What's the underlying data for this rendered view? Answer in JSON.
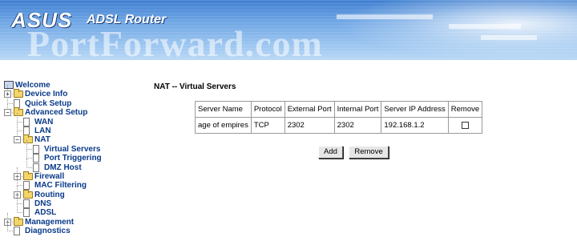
{
  "header": {
    "brand": "ASUS",
    "product": "ADSL Router",
    "watermark": "PortForward.com"
  },
  "nav": {
    "items": [
      {
        "label": "Welcome",
        "level": 0,
        "icon": "computer-icon"
      },
      {
        "label": "Device Info",
        "level": 1,
        "icon": "folder-icon",
        "toggle": "+"
      },
      {
        "label": "Quick Setup",
        "level": 1,
        "icon": "document-icon"
      },
      {
        "label": "Advanced Setup",
        "level": 1,
        "icon": "folder-icon",
        "toggle": "−"
      },
      {
        "label": "WAN",
        "level": 2,
        "icon": "document-icon"
      },
      {
        "label": "LAN",
        "level": 2,
        "icon": "document-icon"
      },
      {
        "label": "NAT",
        "level": 2,
        "icon": "folder-icon",
        "toggle": "−"
      },
      {
        "label": "Virtual Servers",
        "level": 3,
        "icon": "document-icon"
      },
      {
        "label": "Port Triggering",
        "level": 3,
        "icon": "document-icon"
      },
      {
        "label": "DMZ Host",
        "level": 3,
        "icon": "document-icon"
      },
      {
        "label": "Firewall",
        "level": 2,
        "icon": "folder-icon",
        "toggle": "+"
      },
      {
        "label": "MAC Filtering",
        "level": 2,
        "icon": "document-icon"
      },
      {
        "label": "Routing",
        "level": 2,
        "icon": "folder-icon",
        "toggle": "+"
      },
      {
        "label": "DNS",
        "level": 2,
        "icon": "document-icon"
      },
      {
        "label": "ADSL",
        "level": 2,
        "icon": "document-icon"
      },
      {
        "label": "Management",
        "level": 1,
        "icon": "folder-icon",
        "toggle": "+"
      },
      {
        "label": "Diagnostics",
        "level": 1,
        "icon": "document-icon"
      }
    ]
  },
  "main": {
    "title": "NAT -- Virtual Servers",
    "table": {
      "headers": [
        "Server Name",
        "Protocol",
        "External Port",
        "Internal Port",
        "Server IP Address",
        "Remove"
      ],
      "rows": [
        {
          "server_name": "age of empires",
          "protocol": "TCP",
          "external_port": "2302",
          "internal_port": "2302",
          "server_ip": "192.168.1.2",
          "remove": false
        }
      ]
    },
    "buttons": {
      "add": "Add",
      "remove": "Remove"
    }
  }
}
